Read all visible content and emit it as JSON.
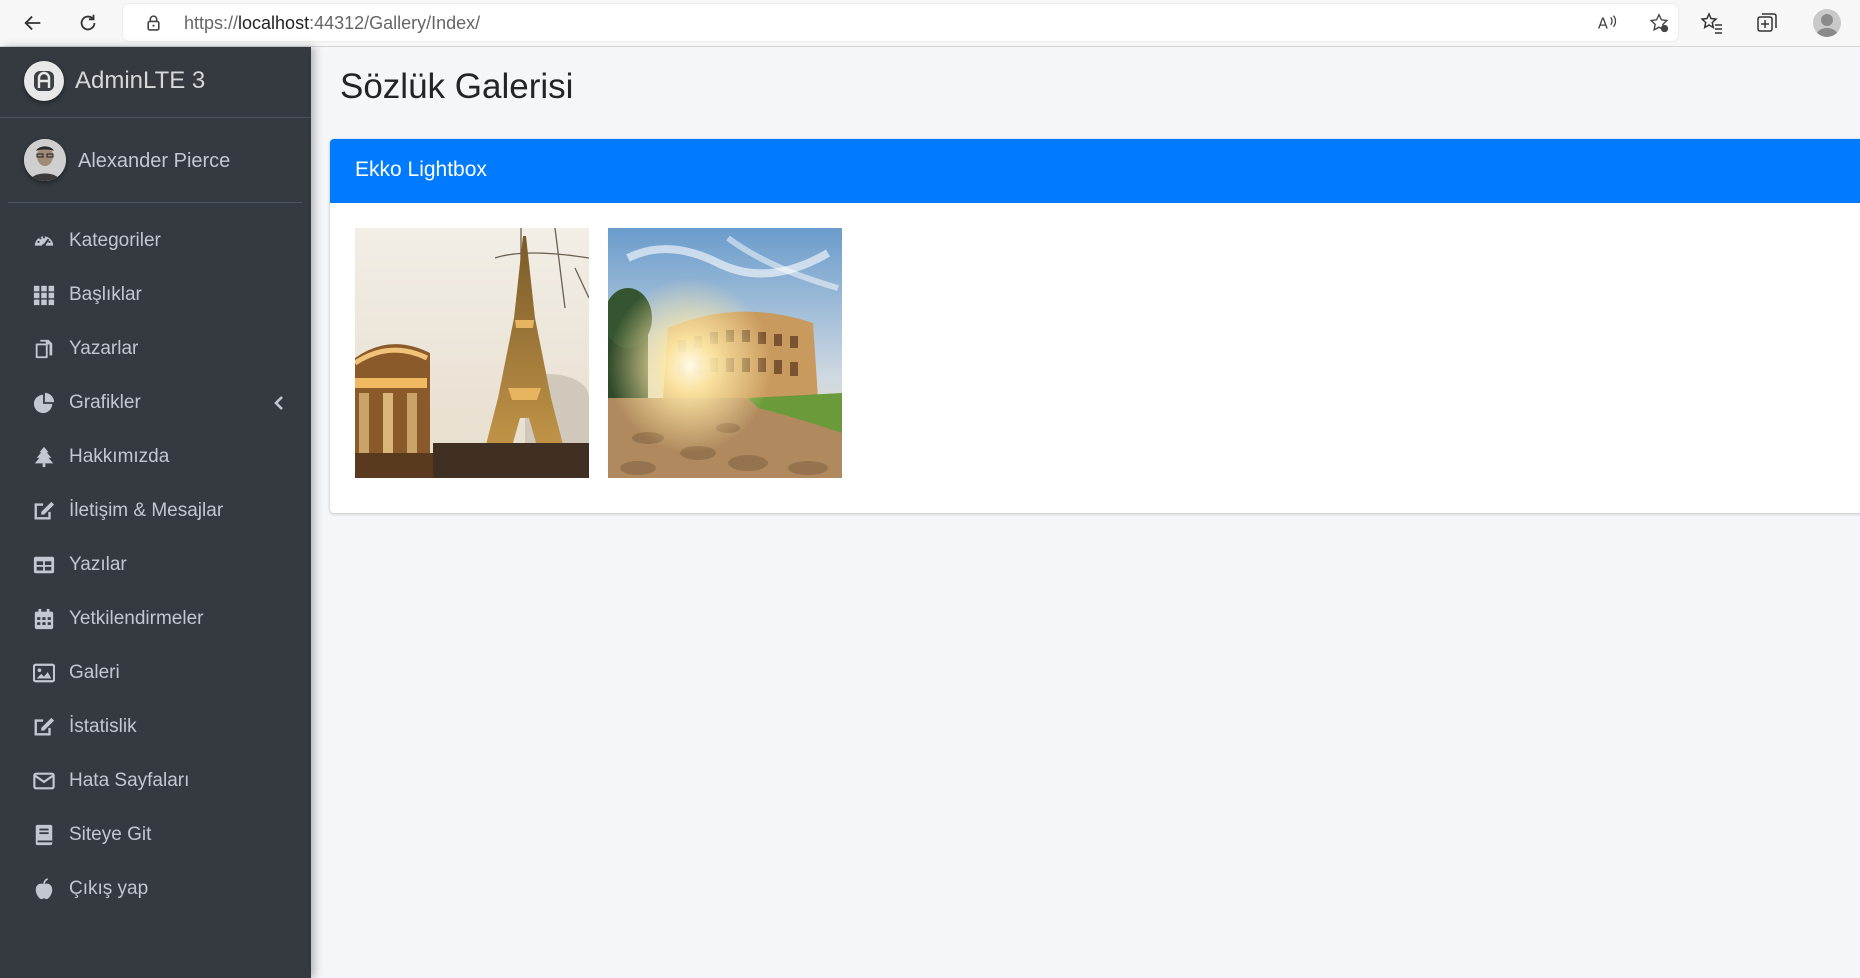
{
  "browser": {
    "url_prefix": "https://",
    "url_host": "localhost",
    "url_rest": ":44312/Gallery/Index/"
  },
  "brand": {
    "name": "AdminLTE 3"
  },
  "user": {
    "name": "Alexander Pierce"
  },
  "sidebar": {
    "items": [
      {
        "label": "Kategoriler",
        "icon": "tachometer-icon"
      },
      {
        "label": "Başlıklar",
        "icon": "grid-icon"
      },
      {
        "label": "Yazarlar",
        "icon": "copy-icon"
      },
      {
        "label": "Grafikler",
        "icon": "pie-chart-icon",
        "has_submenu": true
      },
      {
        "label": "Hakkımızda",
        "icon": "tree-icon"
      },
      {
        "label": "İletişim & Mesajlar",
        "icon": "edit-icon"
      },
      {
        "label": "Yazılar",
        "icon": "table-icon"
      },
      {
        "label": "Yetkilendirmeler",
        "icon": "calendar-icon"
      },
      {
        "label": "Galeri",
        "icon": "image-icon"
      },
      {
        "label": "İstatislik",
        "icon": "edit-icon"
      },
      {
        "label": "Hata Sayfaları",
        "icon": "envelope-icon"
      },
      {
        "label": "Siteye Git",
        "icon": "book-icon"
      },
      {
        "label": "Çıkış yap",
        "icon": "apple-icon"
      }
    ]
  },
  "page": {
    "title": "Sözlük Galerisi"
  },
  "card": {
    "title": "Ekko Lightbox",
    "images": [
      {
        "name": "eiffel-tower-photo"
      },
      {
        "name": "colosseum-photo"
      }
    ]
  },
  "colors": {
    "primary": "#007bff",
    "sidebar_bg": "#343a40",
    "content_bg": "#f4f6f9"
  }
}
